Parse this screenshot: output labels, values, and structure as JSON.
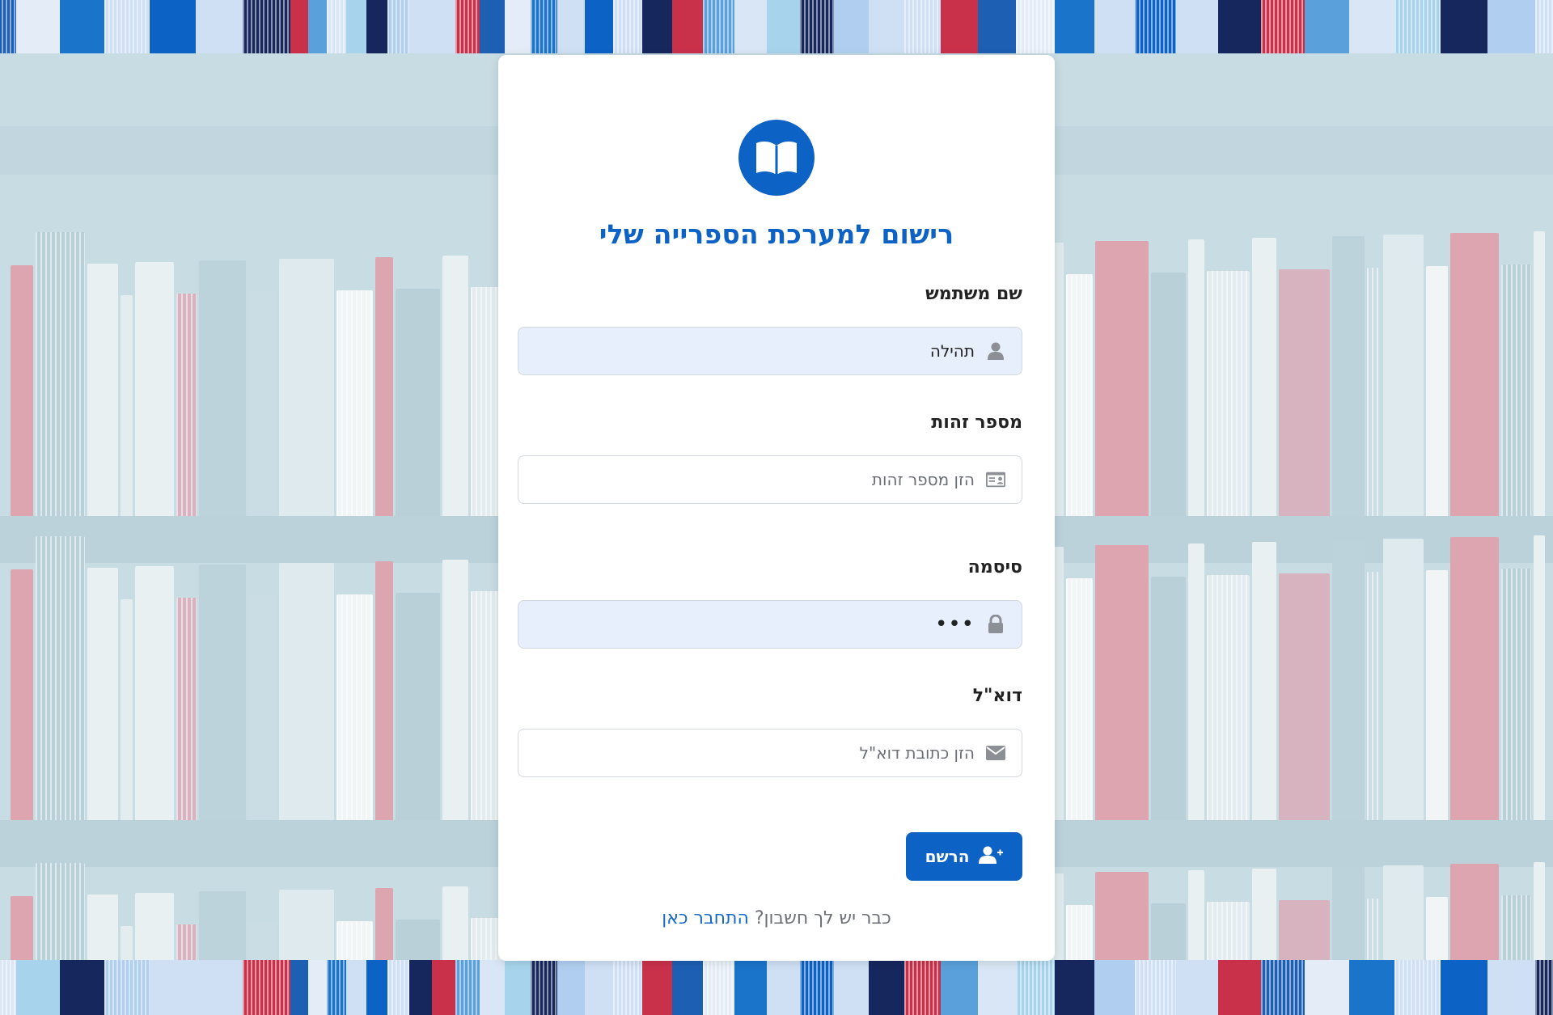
{
  "card": {
    "title": "רישום למערכת הספרייה שלי"
  },
  "form": {
    "username": {
      "label": "שם משתמש",
      "value": "תהילה",
      "icon": "user-icon"
    },
    "id_number": {
      "label": "מספר זהות",
      "placeholder": "הזן מספר זהות",
      "icon": "id-card-icon"
    },
    "password": {
      "label": "סיסמה",
      "value_masked": "•••",
      "icon": "lock-icon"
    },
    "email": {
      "label": "דוא\"ל",
      "placeholder": "הזן כתובת דוא\"ל",
      "icon": "envelope-icon"
    }
  },
  "register_button": {
    "label": "הרשם",
    "icon": "user-plus-icon"
  },
  "footer": {
    "prompt": "כבר יש לך חשבון?",
    "link_text": "התחבר כאן"
  },
  "colors": {
    "primary": "#0d62c6",
    "input_filled_bg": "#e7effc",
    "background": "#c8dce3"
  }
}
